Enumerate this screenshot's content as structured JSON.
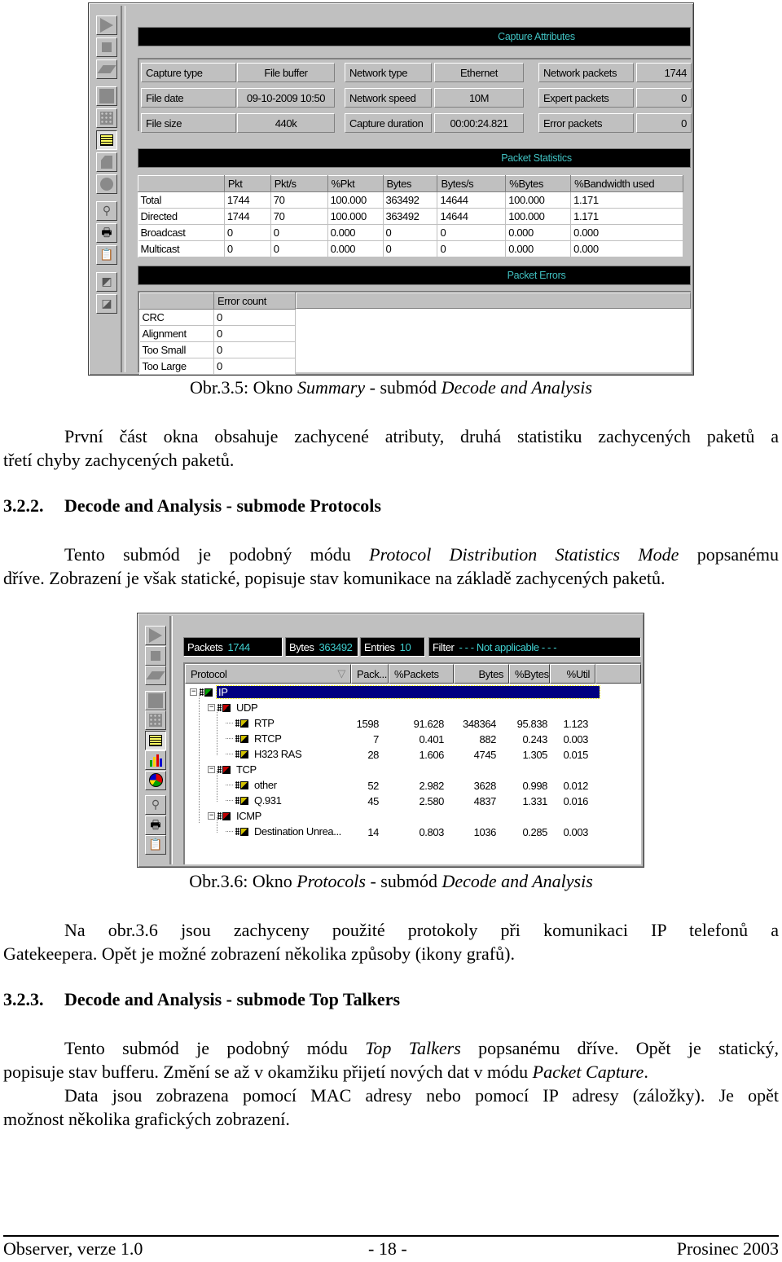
{
  "figure1": {
    "toolbar_icons": [
      "play-icon",
      "stop-icon",
      "eraser-icon",
      "window-icon",
      "dots-icon",
      "list-view-icon",
      "page-icon",
      "circle-icon",
      "find-icon",
      "print-icon",
      "clipboard-icon",
      "tool1-icon",
      "tool2-icon"
    ],
    "capture_attributes": {
      "title": "Capture Attributes",
      "rows": [
        [
          {
            "label": "Capture type",
            "value": "File buffer"
          },
          {
            "label": "Network type",
            "value": "Ethernet"
          },
          {
            "label": "Network packets",
            "value": "1744"
          }
        ],
        [
          {
            "label": "File date",
            "value": "09-10-2009 10:50"
          },
          {
            "label": "Network speed",
            "value": "10M"
          },
          {
            "label": "Expert packets",
            "value": "0"
          }
        ],
        [
          {
            "label": "File size",
            "value": "440k"
          },
          {
            "label": "Capture duration",
            "value": "00:00:24.821"
          },
          {
            "label": "Error packets",
            "value": "0"
          }
        ]
      ]
    },
    "packet_statistics": {
      "title": "Packet Statistics",
      "columns": [
        "",
        "Pkt",
        "Pkt/s",
        "%Pkt",
        "Bytes",
        "Bytes/s",
        "%Bytes",
        "%Bandwidth used"
      ],
      "rows": [
        [
          "Total",
          "1744",
          "70",
          "100.000",
          "363492",
          "14644",
          "100.000",
          "1.171"
        ],
        [
          "Directed",
          "1744",
          "70",
          "100.000",
          "363492",
          "14644",
          "100.000",
          "1.171"
        ],
        [
          "Broadcast",
          "0",
          "0",
          "0.000",
          "0",
          "0",
          "0.000",
          "0.000"
        ],
        [
          "Multicast",
          "0",
          "0",
          "0.000",
          "0",
          "0",
          "0.000",
          "0.000"
        ]
      ]
    },
    "packet_errors": {
      "title": "Packet Errors",
      "columns": [
        "",
        "Error count"
      ],
      "rows": [
        [
          "CRC",
          "0"
        ],
        [
          "Alignment",
          "0"
        ],
        [
          "Too Small",
          "0"
        ],
        [
          "Too Large",
          "0"
        ]
      ]
    },
    "caption": {
      "prefix": "Obr.3.5: Okno ",
      "italic1": "Summary",
      "mid": " - submód ",
      "italic2": "Decode and Analysis"
    }
  },
  "paragraph1": {
    "line1": "První část okna obsahuje zachycené atributy, druhá statistiku zachycených paketů a",
    "line2": "třetí chyby zachycených paketů."
  },
  "section_322": {
    "number": "3.2.2.",
    "title": "Decode and Analysis - submode Protocols"
  },
  "paragraph2": {
    "a": "Tento submód je podobný módu ",
    "italic": "Protocol Distribution Statistics Mode",
    "b": " popsanému",
    "line2": "dříve. Zobrazení je však statické, popisuje stav komunikace na základě zachycených paketů."
  },
  "figure2": {
    "toolbar_icons": [
      "play-icon",
      "stop-icon",
      "eraser-icon",
      "window-icon",
      "dots-icon",
      "list-view-icon",
      "bar-chart-icon",
      "pie-chart-icon",
      "find-icon",
      "print-icon",
      "clipboard-icon"
    ],
    "status": {
      "packets_label": "Packets",
      "packets_value": "1744",
      "bytes_label": "Bytes",
      "bytes_value": "363492",
      "entries_label": "Entries",
      "entries_value": "10",
      "filter_label": "Filter",
      "filter_value": "- - - Not applicable - - -"
    },
    "columns": [
      "Protocol",
      "Pack...",
      "%Packets",
      "Bytes",
      "%Bytes",
      "%Util"
    ],
    "sort_indicator": "▽",
    "tree": [
      {
        "name": "IP",
        "level": 0,
        "expanded": true,
        "selected": true,
        "color": "#00a000",
        "values": [
          "",
          "",
          "",
          "",
          ""
        ]
      },
      {
        "name": "UDP",
        "level": 1,
        "expanded": true,
        "color": "#c00000",
        "values": [
          "",
          "",
          "",
          "",
          ""
        ]
      },
      {
        "name": "RTP",
        "level": 2,
        "color": "#d0c000",
        "values": [
          "1598",
          "91.628",
          "348364",
          "95.838",
          "1.123"
        ]
      },
      {
        "name": "RTCP",
        "level": 2,
        "color": "#d0c000",
        "values": [
          "7",
          "0.401",
          "882",
          "0.243",
          "0.003"
        ]
      },
      {
        "name": "H323 RAS",
        "level": 2,
        "color": "#d0c000",
        "values": [
          "28",
          "1.606",
          "4745",
          "1.305",
          "0.015"
        ]
      },
      {
        "name": "TCP",
        "level": 1,
        "expanded": true,
        "color": "#c00000",
        "values": [
          "",
          "",
          "",
          "",
          ""
        ]
      },
      {
        "name": "other",
        "level": 2,
        "color": "#d0c000",
        "values": [
          "52",
          "2.982",
          "3628",
          "0.998",
          "0.012"
        ]
      },
      {
        "name": "Q.931",
        "level": 2,
        "color": "#d0c000",
        "values": [
          "45",
          "2.580",
          "4837",
          "1.331",
          "0.016"
        ]
      },
      {
        "name": "ICMP",
        "level": 1,
        "expanded": true,
        "color": "#c00000",
        "values": [
          "",
          "",
          "",
          "",
          ""
        ]
      },
      {
        "name": "Destination Unrea...",
        "level": 2,
        "color": "#d0c000",
        "values": [
          "14",
          "0.803",
          "1036",
          "0.285",
          "0.003"
        ]
      }
    ],
    "caption": {
      "prefix": "Obr.3.6: Okno ",
      "italic1": "Protocols",
      "mid": " - submód ",
      "italic2": "Decode and Analysis"
    }
  },
  "paragraph3": {
    "line1": "Na obr.3.6 jsou zachyceny použité protokoly při komunikaci IP telefonů a",
    "line2": "Gatekeepera. Opět je možné zobrazení několika způsoby (ikony grafů)."
  },
  "section_323": {
    "number": "3.2.3.",
    "title": "Decode and Analysis - submode Top Talkers"
  },
  "paragraph4": {
    "a": "Tento submód je podobný módu ",
    "italic": "Top Talkers",
    "b": " popsanému dříve. Opět je statický,",
    "line2a": "popisuje stav bufferu. Změní se až v okamžiku přijetí nových dat v módu ",
    "line2italic": "Packet Capture",
    "line2b": "."
  },
  "paragraph5": {
    "line1": "Data jsou zobrazena pomocí MAC adresy nebo pomocí IP adresy (záložky). Je opět",
    "line2": "možnost několika grafických zobrazení."
  },
  "footer": {
    "left": "Observer, verze 1.0",
    "center": "- 18 -",
    "right": "Prosinec 2003"
  }
}
